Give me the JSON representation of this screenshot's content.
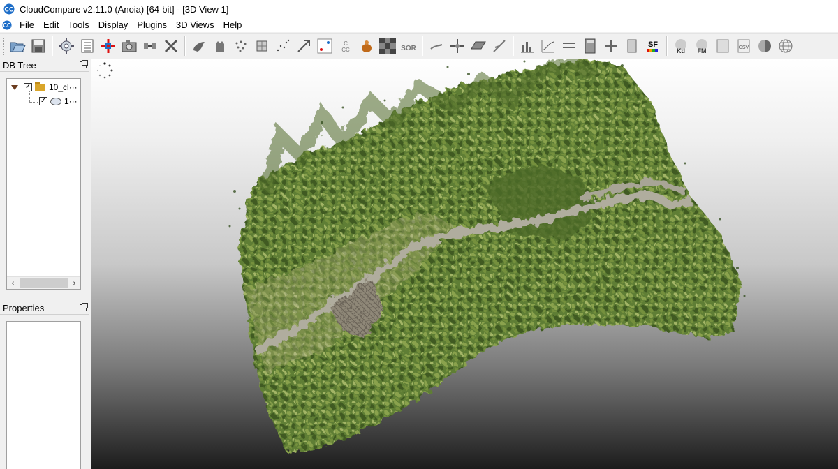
{
  "window": {
    "title": "CloudCompare v2.11.0 (Anoia) [64-bit] - [3D View 1]"
  },
  "menu": [
    "File",
    "Edit",
    "Tools",
    "Display",
    "Plugins",
    "3D Views",
    "Help"
  ],
  "toolbar": {
    "sor_label": "SOR",
    "sf_label": "SF",
    "kd_label": "Kd",
    "fm_label": "FM",
    "csv_label": "CSV"
  },
  "db_tree": {
    "title": "DB Tree",
    "items": [
      {
        "label": "10_cl···",
        "checked": true,
        "type": "folder"
      },
      {
        "label": "1···",
        "checked": true,
        "type": "cloud"
      }
    ]
  },
  "properties": {
    "title": "Properties"
  },
  "colors": {
    "accent": "#1e6ec8",
    "vegetation": "#6d8a3a",
    "path": "#a8a89a"
  },
  "icons": [
    "open-folder-icon",
    "save-icon",
    "gear-icon",
    "list-icon",
    "crosshair-icon",
    "camera-icon",
    "merge-icon",
    "delete-icon"
  ]
}
